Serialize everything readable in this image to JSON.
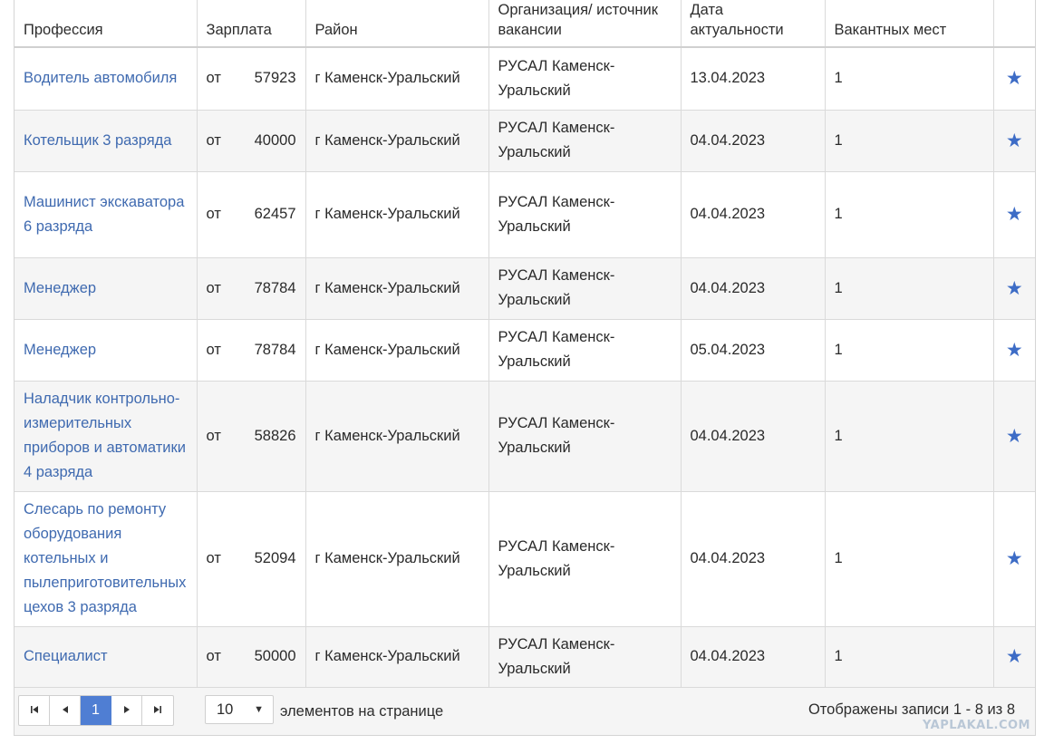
{
  "columns": [
    {
      "label": "Профессия"
    },
    {
      "label": "Зарплата"
    },
    {
      "label": "Район"
    },
    {
      "label": "Организация/ источник вакансии"
    },
    {
      "label": "Дата актуальности"
    },
    {
      "label": "Вакантных мест"
    },
    {
      "label": ""
    }
  ],
  "rows": [
    {
      "profession": "Водитель автомобиля",
      "salary_prefix": "от",
      "salary": "57923",
      "district": "г Каменск-Уральский",
      "organization": "РУСАЛ Каменск-Уральский",
      "date": "13.04.2023",
      "vacancies": "1",
      "star": "★"
    },
    {
      "profession": "Котельщик 3 разряда",
      "salary_prefix": "от",
      "salary": "40000",
      "district": "г Каменск-Уральский",
      "organization": "РУСАЛ Каменск-Уральский",
      "date": "04.04.2023",
      "vacancies": "1",
      "star": "★"
    },
    {
      "profession": "Машинист экскаватора 6 разряда",
      "salary_prefix": "от",
      "salary": "62457",
      "district": "г Каменск-Уральский",
      "organization": "РУСАЛ Каменск-Уральский",
      "date": "04.04.2023",
      "vacancies": "1",
      "star": "★"
    },
    {
      "profession": "Менеджер",
      "salary_prefix": "от",
      "salary": "78784",
      "district": "г Каменск-Уральский",
      "organization": "РУСАЛ Каменск-Уральский",
      "date": "04.04.2023",
      "vacancies": "1",
      "star": "★"
    },
    {
      "profession": "Менеджер",
      "salary_prefix": "от",
      "salary": "78784",
      "district": "г Каменск-Уральский",
      "organization": "РУСАЛ Каменск-Уральский",
      "date": "05.04.2023",
      "vacancies": "1",
      "star": "★"
    },
    {
      "profession": "Наладчик контрольно-измерительных приборов и автоматики 4 разряда",
      "salary_prefix": "от",
      "salary": "58826",
      "district": "г Каменск-Уральский",
      "organization": "РУСАЛ Каменск-Уральский",
      "date": "04.04.2023",
      "vacancies": "1",
      "star": "★"
    },
    {
      "profession": "Слесарь по ремонту оборудования котельных и пылеприготовительных цехов 3 разряда",
      "salary_prefix": "от",
      "salary": "52094",
      "district": "г Каменск-Уральский",
      "organization": "РУСАЛ Каменск-Уральский",
      "date": "04.04.2023",
      "vacancies": "1",
      "star": "★"
    },
    {
      "profession": "Специалист",
      "salary_prefix": "от",
      "salary": "50000",
      "district": "г Каменск-Уральский",
      "organization": "РУСАЛ Каменск-Уральский",
      "date": "04.04.2023",
      "vacancies": "1",
      "star": "★"
    }
  ],
  "pager": {
    "first_icon": "⏮",
    "prev_icon": "◀",
    "current_page": "1",
    "next_icon": "▶",
    "last_icon": "⏭",
    "page_size": "10",
    "page_size_caret": "▼",
    "page_size_label": "элементов на странице",
    "records_info": "Отображены записи 1 - 8 из 8"
  },
  "watermark": "YAPLAKAL.COM",
  "colors": {
    "link": "#3f6ab0",
    "accent": "#4f7ed3",
    "star": "#3d6cc6",
    "row_alt": "#f5f5f5"
  }
}
